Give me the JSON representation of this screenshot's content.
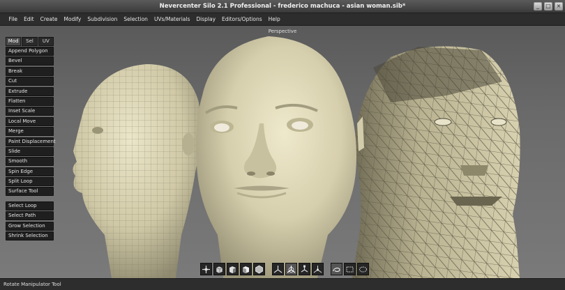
{
  "window": {
    "title": "Nevercenter Silo 2.1 Professional - frederico machuca - asian woman.sib*",
    "buttons": [
      "_",
      "□",
      "×"
    ]
  },
  "menubar": {
    "items": [
      "File",
      "Edit",
      "Create",
      "Modify",
      "Subdivision",
      "Selection",
      "UVs/Materials",
      "Display",
      "Editors/Options",
      "Help"
    ]
  },
  "viewport": {
    "label": "Perspective"
  },
  "toolpanel": {
    "tabs": [
      "Mod",
      "Sel",
      "UV"
    ],
    "active_tab": "Mod",
    "tools": [
      "Append Polygon",
      "Bevel",
      "Break",
      "Cut",
      "Extrude",
      "Flatten",
      "Inset Scale",
      "Local Move",
      "Merge",
      "Paint Displacement",
      "Slide",
      "Smooth",
      "Spin Edge",
      "Split Loop",
      "Surface Tool"
    ],
    "selection_tools": [
      "Select Loop",
      "Select Path",
      "Grow Selection",
      "Shrink Selection"
    ]
  },
  "bottom_toolbar": {
    "icons": [
      "move-manipulator-icon",
      "rotate-cube-icon",
      "scale-cube-icon",
      "universal-cube-icon",
      "cube-outline-icon",
      "axis-move-icon",
      "axis-rotate-icon",
      "axis-scale-icon",
      "axis-universal-icon",
      "lasso-select-icon",
      "rect-select-icon",
      "paint-select-icon"
    ]
  },
  "statusbar": {
    "text": "Rotate Manipulator Tool"
  },
  "colors": {
    "skin": "#d9d3b3",
    "wire": "#6e6a55",
    "panel": "#1f1f1f"
  }
}
